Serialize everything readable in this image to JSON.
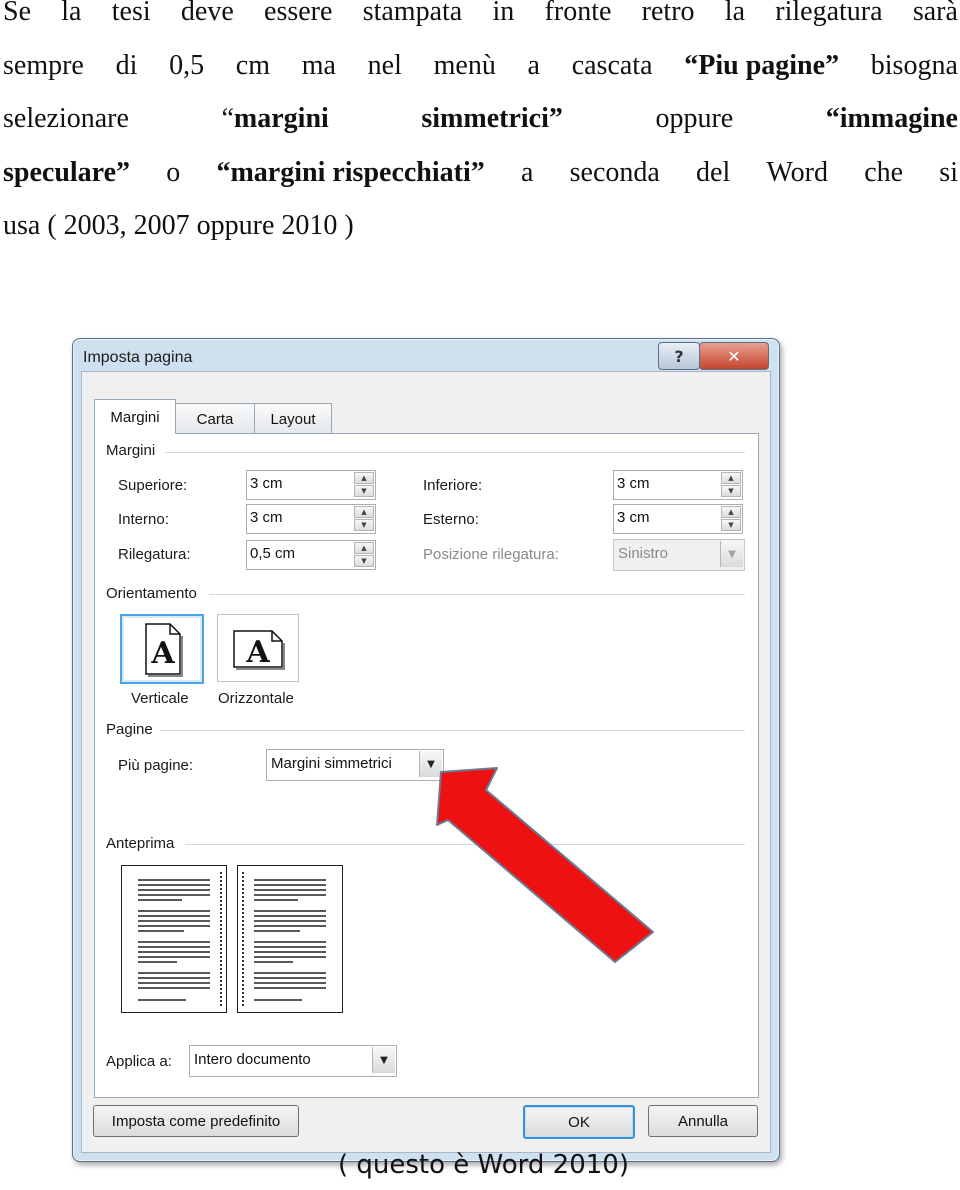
{
  "paragraph": {
    "line1": [
      "Se",
      "la",
      "tesi",
      "deve",
      "essere",
      "stampata",
      "in",
      "fronte",
      "retro",
      "la",
      "rilegatura",
      "sarà"
    ],
    "line2": {
      "pre": [
        "sempre",
        "di",
        "0,5",
        "cm",
        "ma",
        "nel",
        "menù",
        "a",
        "cascata"
      ],
      "open_quote": "“",
      "bold": "Piu pagine",
      "close_quote": "”",
      "post": "bisogna"
    },
    "line3": {
      "word1": "selezionare",
      "open_quote1": "“",
      "bold1": "margini",
      "bold2": "simmetrici",
      "close_quote1": "”",
      "word2": "oppure",
      "open_quote2": "“",
      "bold3": "immagine"
    },
    "line4": {
      "bold1": "speculare",
      "close_quote1": "”",
      "word1": "o",
      "open_quote2": "“",
      "bold2": "margini rispecchiati",
      "close_quote2": "”",
      "rest": [
        "a",
        "seconda",
        "del",
        "Word",
        "che",
        "si"
      ]
    },
    "line5": "usa ( 2003, 2007 oppure 2010 )"
  },
  "dialog": {
    "title": "Imposta pagina",
    "help_label": "?",
    "close_label": "✕",
    "tabs": [
      "Margini",
      "Carta",
      "Layout"
    ],
    "margins_section": "Margini",
    "fields": {
      "superiore": {
        "label": "Superiore:",
        "value": "3 cm"
      },
      "inferiore": {
        "label": "Inferiore:",
        "value": "3 cm"
      },
      "interno": {
        "label": "Interno:",
        "value": "3 cm"
      },
      "esterno": {
        "label": "Esterno:",
        "value": "3 cm"
      },
      "rilegatura": {
        "label": "Rilegatura:",
        "value": "0,5 cm"
      },
      "posizione": {
        "label": "Posizione rilegatura:",
        "value": "Sinistro"
      }
    },
    "orientation_section": "Orientamento",
    "orientation": {
      "portrait": "Verticale",
      "landscape": "Orizzontale",
      "glyph": "A"
    },
    "pages_section": "Pagine",
    "pages_label": "Più pagine:",
    "pages_value": "Margini simmetrici",
    "preview_section": "Anteprima",
    "apply_label": "Applica a:",
    "apply_value": "Intero documento",
    "buttons": {
      "default": "Imposta come predefinito",
      "ok": "OK",
      "cancel": "Annulla"
    },
    "arrow_color": "#ee1111"
  },
  "caption": "( questo è Word 2010)"
}
